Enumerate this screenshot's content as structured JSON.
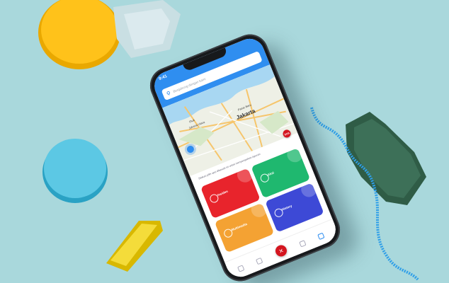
{
  "phone": {
    "status_time": "9:41",
    "search_placeholder": "Bergabung dengan kami",
    "map_labels": [
      "Pasar Baru",
      "Jakarta",
      "Pluit",
      "Jakarta Utara"
    ],
    "help_text": "Silakan pilih opsi dibawah ini untuk menyampaikan laporan",
    "sos_label": "SOS",
    "tiles": [
      {
        "name": "Insiden",
        "color": "#e8242c"
      },
      {
        "name": "Aksi",
        "color": "#1fb86f"
      },
      {
        "name": "Multimedia",
        "color": "#f4a233"
      },
      {
        "name": "History",
        "color": "#3d49d6"
      }
    ],
    "center_button_icon": "close-icon",
    "accent": "#2f8ef0"
  }
}
